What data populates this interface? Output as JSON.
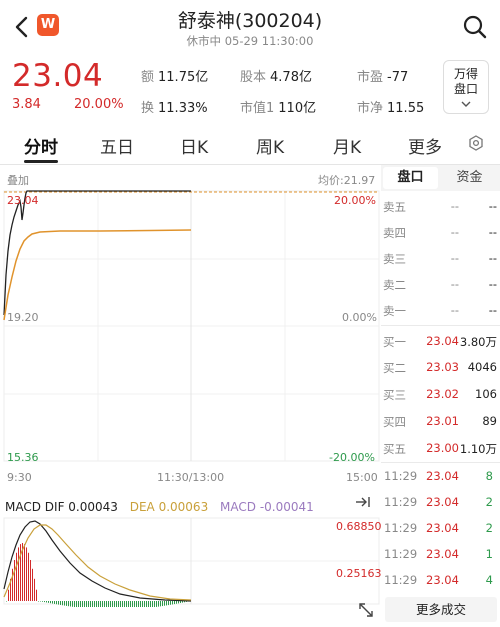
{
  "header": {
    "title": "舒泰神(300204)",
    "market_status": "休市中  05-29 11:30:00",
    "logo_letter": "W"
  },
  "quote": {
    "price": "23.04",
    "change": "3.84",
    "change_pct": "20.00%",
    "stats": [
      {
        "key": "额",
        "value": "11.75亿"
      },
      {
        "key": "股本",
        "value": "4.78亿"
      },
      {
        "key": "市盈",
        "value": "-77"
      },
      {
        "key": "换",
        "value": "11.33%"
      },
      {
        "key": "市值1",
        "value": "110亿"
      },
      {
        "key": "市净",
        "value": "11.55"
      }
    ],
    "wande_label_1": "万得",
    "wande_label_2": "盘口"
  },
  "tabs": [
    "分时",
    "五日",
    "日K",
    "周K",
    "月K",
    "更多"
  ],
  "intraday": {
    "overlay_label": "叠加",
    "avg_price_label": "均价:21.97",
    "price_high": "23.04",
    "price_mid": "19.20",
    "price_low": "15.36",
    "pct_high": "20.00%",
    "pct_mid": "0.00%",
    "pct_low": "-20.00%",
    "time_start": "9:30",
    "time_mid": "11:30/13:00",
    "time_end": "15:00"
  },
  "macd": {
    "dif_label": "MACD DIF 0.00043",
    "dea_label": "DEA 0.00063",
    "macd_label": "MACD -0.00041",
    "val_high": "0.68850",
    "val_mid": "0.25163"
  },
  "order_book": {
    "tabs": [
      "盘口",
      "资金"
    ],
    "sell": [
      {
        "name": "卖五",
        "price": "--",
        "vol": "--"
      },
      {
        "name": "卖四",
        "price": "--",
        "vol": "--"
      },
      {
        "name": "卖三",
        "price": "--",
        "vol": "--"
      },
      {
        "name": "卖二",
        "price": "--",
        "vol": "--"
      },
      {
        "name": "卖一",
        "price": "--",
        "vol": "--"
      }
    ],
    "buy": [
      {
        "name": "买一",
        "price": "23.04",
        "vol": "3.80万"
      },
      {
        "name": "买二",
        "price": "23.03",
        "vol": "4046"
      },
      {
        "name": "买三",
        "price": "23.02",
        "vol": "106"
      },
      {
        "name": "买四",
        "price": "23.01",
        "vol": "89"
      },
      {
        "name": "买五",
        "price": "23.00",
        "vol": "1.10万"
      }
    ]
  },
  "trades": [
    {
      "time": "11:29",
      "price": "23.04",
      "vol": "8"
    },
    {
      "time": "11:29",
      "price": "23.04",
      "vol": "2"
    },
    {
      "time": "11:29",
      "price": "23.04",
      "vol": "2"
    },
    {
      "time": "11:29",
      "price": "23.04",
      "vol": "1"
    },
    {
      "time": "11:29",
      "price": "23.04",
      "vol": "4"
    }
  ],
  "more_trades_label": "更多成交",
  "colors": {
    "up": "#d32a2a",
    "down": "#2e9a4c",
    "avg": "#e0932c",
    "macd_dea": "#9b7bbf"
  }
}
